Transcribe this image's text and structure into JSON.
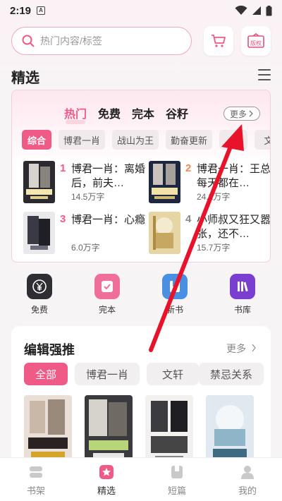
{
  "status_bar": {
    "time": "2:19",
    "notification_badge": "A"
  },
  "search": {
    "placeholder": "热门内容/标签"
  },
  "top_buttons": {
    "copyright_label": "版权"
  },
  "section": {
    "title": "精选"
  },
  "hot_tabs": [
    {
      "label": "热门",
      "active": true
    },
    {
      "label": "免费",
      "active": false
    },
    {
      "label": "完本",
      "active": false
    },
    {
      "label": "谷籽",
      "active": false
    }
  ],
  "hot_more_label": "更多",
  "hot_chips": [
    {
      "label": "综合",
      "active": true
    },
    {
      "label": "博君一肖",
      "active": false
    },
    {
      "label": "战山为王",
      "active": false
    },
    {
      "label": "勤奋更新",
      "active": false
    },
    {
      "label": "",
      "active": false
    },
    {
      "label": "文",
      "active": false
    }
  ],
  "rank_list": [
    {
      "rank": "1",
      "title": "博君一肖：离婚后，前夫…",
      "words": "14.5万字"
    },
    {
      "rank": "2",
      "title": "博君一肖：王总每天都在…",
      "words": "24.2万字"
    },
    {
      "rank": "3",
      "title": "博君一肖：心瘾",
      "words": "6.0万字"
    },
    {
      "rank": "4",
      "title": "小师叔又狂又嚣张，还不…",
      "words": "15.7万字"
    }
  ],
  "quick_entries": [
    {
      "label": "免费",
      "icon": "yen-coin-icon"
    },
    {
      "label": "完本",
      "icon": "checkbox-icon"
    },
    {
      "label": "新书",
      "icon": "book-icon"
    },
    {
      "label": "书库",
      "icon": "library-icon"
    }
  ],
  "editor": {
    "title": "编辑强推",
    "more_label": "更多",
    "chips": [
      {
        "label": "全部",
        "active": true
      },
      {
        "label": "博君一肖",
        "active": false
      },
      {
        "label": "文轩",
        "active": false
      },
      {
        "label": "禁忌关系",
        "active": false
      }
    ]
  },
  "bottom_nav": [
    {
      "label": "书架",
      "active": false
    },
    {
      "label": "精选",
      "active": true
    },
    {
      "label": "短篇",
      "active": false
    },
    {
      "label": "我的",
      "active": false
    }
  ],
  "colors": {
    "accent": "#f05a86",
    "annotation_arrow": "#e8132b"
  }
}
